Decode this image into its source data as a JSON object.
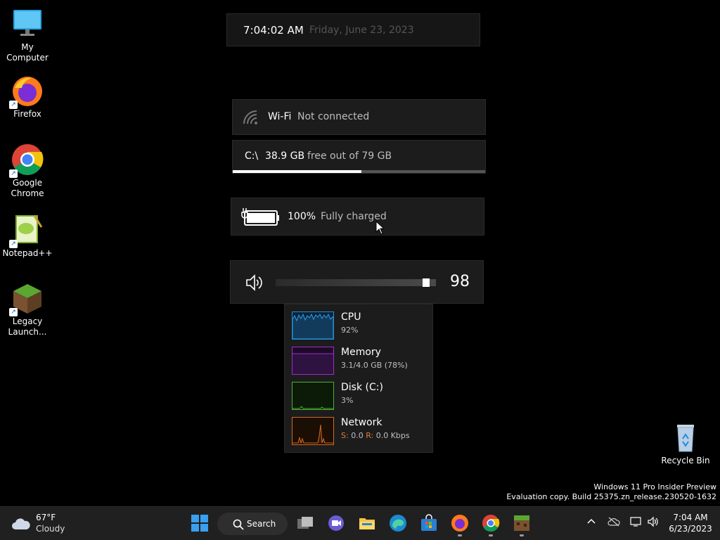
{
  "desktop": {
    "icons": [
      {
        "label": "My Computer"
      },
      {
        "label": "Firefox"
      },
      {
        "label": "Google Chrome"
      },
      {
        "label": "Notepad++"
      },
      {
        "label": "Legacy Launch..."
      }
    ],
    "recycle_bin": {
      "label": "Recycle Bin"
    },
    "watermark": {
      "line1": "Windows 11 Pro Insider Preview",
      "line2": "Evaluation copy. Build 25375.zn_release.230520-1632"
    }
  },
  "clock_widget": {
    "time": "7:04:02 AM",
    "date": "Friday, June 23, 2023"
  },
  "wifi_widget": {
    "name": "Wi-Fi",
    "status": "Not connected",
    "icon": "wifi-icon"
  },
  "disk_widget": {
    "drive": "C:\\",
    "free": "38.9 GB",
    "suffix": "free out of 79 GB",
    "used_fraction": 0.51
  },
  "battery_widget": {
    "percent": "100%",
    "status": "Fully charged",
    "icon": "battery-charging-icon"
  },
  "volume_widget": {
    "value": "98",
    "level": 0.98,
    "icon": "speaker-icon"
  },
  "perf_panel": {
    "items": [
      {
        "name": "CPU",
        "value": "92%",
        "color": "#1e90d8"
      },
      {
        "name": "Memory",
        "value": "3.1/4.0 GB (78%)",
        "color": "#9b30c8"
      },
      {
        "name": "Disk (C:)",
        "value": "3%",
        "color": "#4fae30"
      },
      {
        "name": "Network",
        "value_send_label": "S:",
        "value_send": "0.0",
        "value_recv_label": "R:",
        "value_recv": "0.0 Kbps",
        "color": "#d2691e",
        "recv_color": "#e07a3a"
      }
    ]
  },
  "taskbar": {
    "weather": {
      "temp": "67°F",
      "condition": "Cloudy",
      "icon": "cloud-icon"
    },
    "search_label": "Search",
    "apps": [
      "start-icon",
      "task-view-icon",
      "chat-icon",
      "file-explorer-icon",
      "edge-icon",
      "store-icon",
      "firefox-icon",
      "chrome-icon",
      "minecraft-icon"
    ],
    "tray_time": "7:04 AM",
    "tray_date": "6/23/2023"
  }
}
